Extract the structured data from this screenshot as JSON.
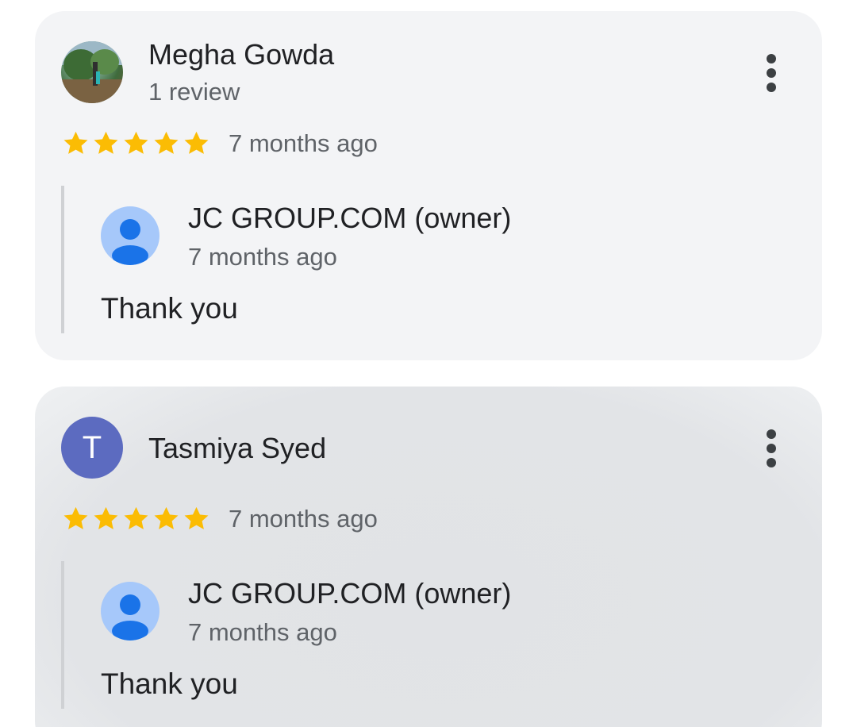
{
  "reviews": [
    {
      "reviewer_name": "Megha Gowda",
      "reviewer_meta": "1 review",
      "avatar_type": "photo",
      "rating": 5,
      "time": "7 months ago",
      "owner_reply": {
        "owner_name": "JC GROUP.COM (owner)",
        "time": "7 months ago",
        "text": "Thank you"
      }
    },
    {
      "reviewer_name": "Tasmiya Syed",
      "avatar_letter": "T",
      "avatar_type": "letter",
      "rating": 5,
      "time": "7 months ago",
      "owner_reply": {
        "owner_name": "JC GROUP.COM (owner)",
        "time": "7 months ago",
        "text": "Thank you"
      }
    }
  ],
  "icons": {
    "star": "star-icon",
    "more": "more-vert-icon",
    "owner_avatar": "person-icon"
  },
  "colors": {
    "star": "#fbbc04",
    "letter_avatar": "#5c6bc0",
    "owner_avatar_bg": "#a6c8fa",
    "owner_avatar_fg": "#1a73e8"
  }
}
